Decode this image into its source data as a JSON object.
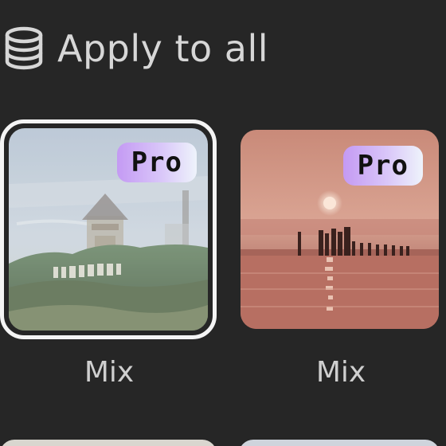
{
  "apply_to_all": {
    "label": "Apply to all",
    "icon": "database-stack-icon"
  },
  "templates": [
    {
      "badge": "Pro",
      "label": "Mix",
      "selected": true,
      "thumbnail": "hills-sign-tower-blend"
    },
    {
      "badge": "Pro",
      "label": "Mix",
      "selected": false,
      "thumbnail": "sunset-sea-pier"
    }
  ],
  "colors": {
    "background": "#262626",
    "text": "#d7d7d7",
    "selected_border": "#f4f4f4",
    "badge_gradient_start": "#c49af3",
    "badge_gradient_end": "#eef3fb",
    "badge_text": "#111111"
  }
}
